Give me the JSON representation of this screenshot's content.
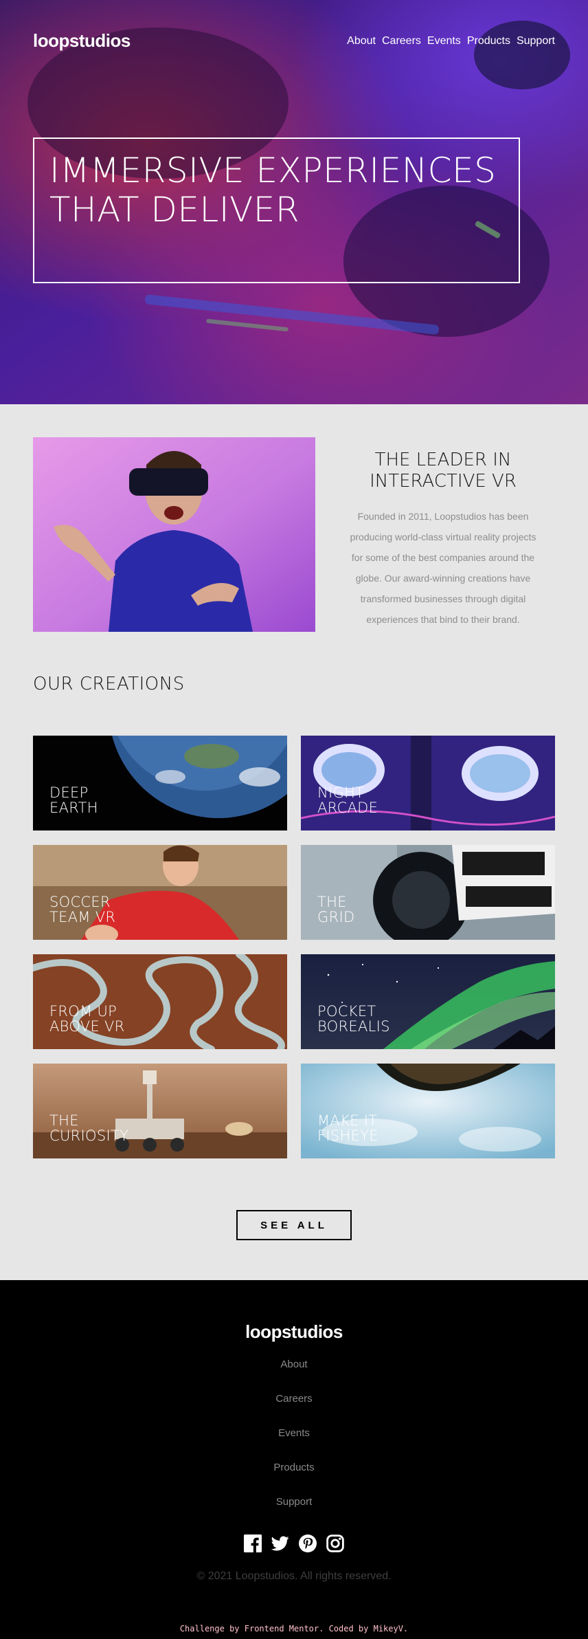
{
  "brand": {
    "name": "loopstudios"
  },
  "nav": {
    "items": [
      {
        "label": "About"
      },
      {
        "label": "Careers"
      },
      {
        "label": "Events"
      },
      {
        "label": "Products"
      },
      {
        "label": "Support"
      }
    ]
  },
  "hero": {
    "title": "IMMERSIVE EXPERIENCES THAT DELIVER",
    "icon": "vr-headset-photo"
  },
  "leader": {
    "title": "THE LEADER IN INTERACTIVE VR",
    "body": "Founded in 2011, Loopstudios has been producing world-class virtual reality projects for some of the best companies around the globe. Our award-winning creations have transformed businesses through digital experiences that bind to their brand.",
    "image": "man-wearing-vr-headset-photo"
  },
  "creations": {
    "title": "OUR CREATIONS",
    "items": [
      {
        "label": "DEEP\nEARTH",
        "image": "earth-from-space-photo"
      },
      {
        "label": "NIGHT\nARCADE",
        "image": "arcade-machines-photo"
      },
      {
        "label": "SOCCER\nTEAM VR",
        "image": "soccer-player-photo"
      },
      {
        "label": "THE\nGRID",
        "image": "race-car-photo"
      },
      {
        "label": "FROM UP\nABOVE VR",
        "image": "winding-road-aerial-photo"
      },
      {
        "label": "POCKET\nBOREALIS",
        "image": "aurora-borealis-photo"
      },
      {
        "label": "THE\nCURIOSITY",
        "image": "mars-rover-photo"
      },
      {
        "label": "MAKE IT\nFISHEYE",
        "image": "fisheye-sky-photo"
      }
    ],
    "see_all_label": "SEE ALL"
  },
  "footer": {
    "brand": "loopstudios",
    "nav": [
      {
        "label": "About"
      },
      {
        "label": "Careers"
      },
      {
        "label": "Events"
      },
      {
        "label": "Products"
      },
      {
        "label": "Support"
      }
    ],
    "socials": [
      {
        "name": "facebook-icon"
      },
      {
        "name": "twitter-icon"
      },
      {
        "name": "pinterest-icon"
      },
      {
        "name": "instagram-icon"
      }
    ],
    "copyright": "© 2021 Loopstudios. All rights reserved.",
    "attribution": "Challenge by Frontend Mentor. Coded by MikeyV."
  },
  "colors": {
    "page_bg": "#e6e6e6",
    "footer_bg": "#000000",
    "muted_text": "#8d8d8d",
    "attribution": "#ffc0cb"
  }
}
